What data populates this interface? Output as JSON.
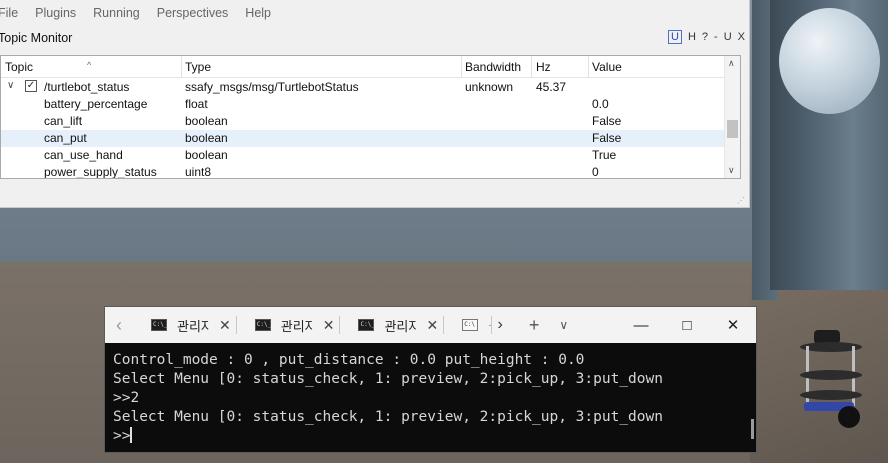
{
  "menu": [
    "File",
    "Plugins",
    "Running",
    "Perspectives",
    "Help"
  ],
  "plugin": {
    "title": "Topic Monitor",
    "buttons": [
      "U",
      "H",
      "?",
      "-",
      "U",
      "X"
    ]
  },
  "table": {
    "headers": [
      "Topic",
      "Type",
      "Bandwidth",
      "Hz",
      "Value"
    ],
    "parent": {
      "topic": "/turtlebot_status",
      "type": "ssafy_msgs/msg/TurtlebotStatus",
      "bandwidth": "unknown",
      "hz": "45.37",
      "checked": "✓"
    },
    "rows": [
      {
        "name": "battery_percentage",
        "type": "float",
        "value": "0.0"
      },
      {
        "name": "can_lift",
        "type": "boolean",
        "value": "False"
      },
      {
        "name": "can_put",
        "type": "boolean",
        "value": "False",
        "selected": true
      },
      {
        "name": "can_use_hand",
        "type": "boolean",
        "value": "True"
      },
      {
        "name": "power_supply_status",
        "type": "uint8",
        "value": "0"
      }
    ]
  },
  "terminal": {
    "tabs": [
      {
        "label": "관리자",
        "icon": "C:\\_"
      },
      {
        "label": "관리자",
        "icon": "C:\\_"
      },
      {
        "label": "관리자",
        "icon": "C:\\_"
      },
      {
        "label": "",
        "icon": "C:\\"
      }
    ],
    "lines": [
      "Control_mode : 0 , put_distance : 0.0 put_height : 0.0",
      "Select Menu [0: status_check, 1: preview, 2:pick_up, 3:put_down",
      ">>2",
      "Select Menu [0: status_check, 1: preview, 2:pick_up, 3:put_down",
      ">>"
    ]
  }
}
